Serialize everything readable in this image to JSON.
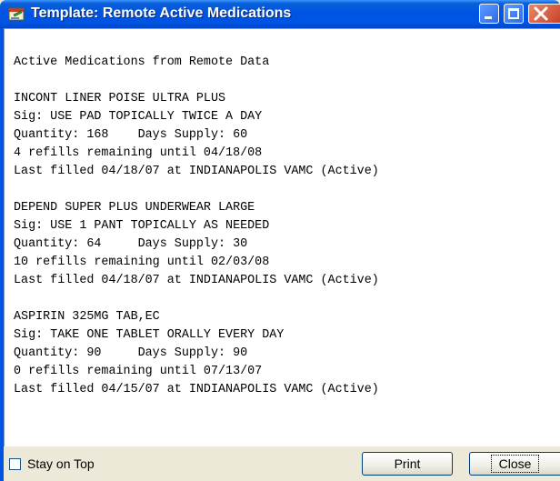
{
  "window": {
    "title": "Template: Remote Active Medications",
    "minimize_symbol": "",
    "maximize_symbol": "",
    "close_symbol": "×"
  },
  "content": {
    "text": "Active Medications from Remote Data\n\nINCONT LINER POISE ULTRA PLUS\nSig: USE PAD TOPICALLY TWICE A DAY\nQuantity: 168    Days Supply: 60\n4 refills remaining until 04/18/08\nLast filled 04/18/07 at INDIANAPOLIS VAMC (Active)\n\nDEPEND SUPER PLUS UNDERWEAR LARGE\nSig: USE 1 PANT TOPICALLY AS NEEDED\nQuantity: 64     Days Supply: 30\n10 refills remaining until 02/03/08\nLast filled 04/18/07 at INDIANAPOLIS VAMC (Active)\n\nASPIRIN 325MG TAB,EC\nSig: TAKE ONE TABLET ORALLY EVERY DAY\nQuantity: 90     Days Supply: 90\n0 refills remaining until 07/13/07\nLast filled 04/15/07 at INDIANAPOLIS VAMC (Active)"
  },
  "footer": {
    "stay_on_top_label": "Stay on Top",
    "stay_on_top_checked": false,
    "print_label": "Print",
    "close_label": "Close"
  }
}
